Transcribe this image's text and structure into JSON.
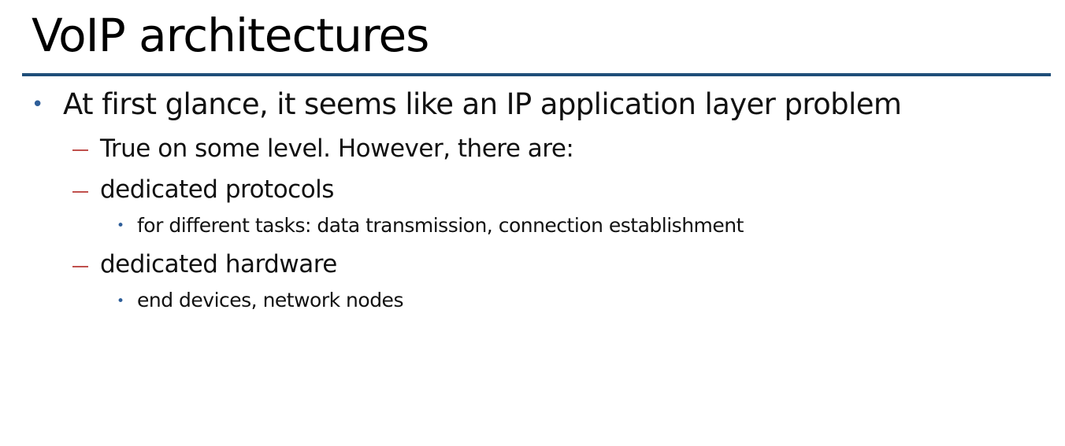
{
  "slide": {
    "title": "VoIP architectures",
    "bullets": [
      {
        "text": "At first glance, it seems like an IP application layer problem",
        "subitems": [
          {
            "text": "True on some level. However, there are:"
          },
          {
            "text": "dedicated protocols",
            "subitems": [
              {
                "text": "for different tasks: data transmission, connection establishment"
              }
            ]
          },
          {
            "text": "dedicated hardware",
            "subitems": [
              {
                "text": "end devices, network nodes"
              }
            ]
          }
        ]
      }
    ]
  },
  "colors": {
    "title_rule": "#1f4e79",
    "bullet": "#2e5e99",
    "dash": "#c0504d",
    "text": "#111111"
  }
}
